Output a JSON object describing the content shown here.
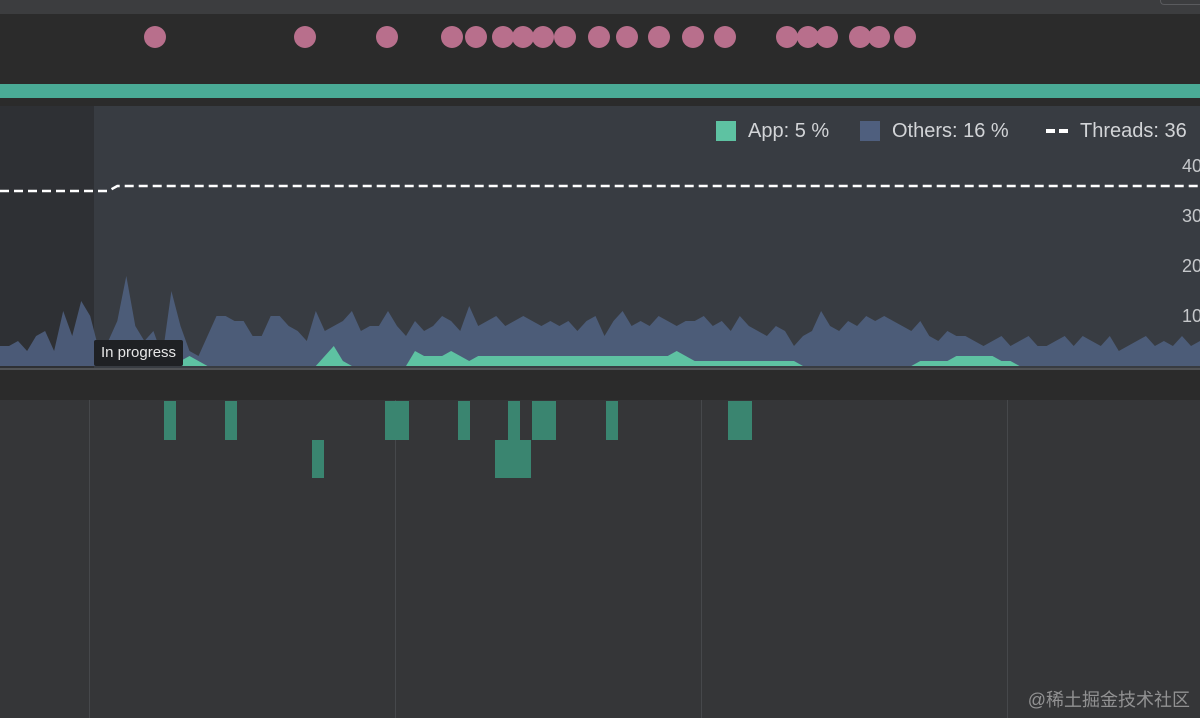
{
  "colors": {
    "app": "#5ec2a2",
    "others": "#4f5f7e",
    "threads": "#ffffff",
    "event": "#b86f8c",
    "status": "#4aab96",
    "thread_block": "#3a8570"
  },
  "legend": {
    "app": "App: 5 %",
    "others": "Others: 16 %",
    "threads": "Threads: 36"
  },
  "axis": {
    "ticks": [
      "40",
      "30",
      "20",
      "10"
    ]
  },
  "tooltip": {
    "text": "In progress"
  },
  "watermark": {
    "text": "@稀土掘金技术社区"
  },
  "chart_data": {
    "type": "area",
    "ylim": [
      0,
      45
    ],
    "series": [
      {
        "name": "Others",
        "values": [
          4,
          4,
          5,
          3,
          6,
          7,
          3,
          11,
          6,
          13,
          10,
          3,
          5,
          9,
          18,
          8,
          5,
          7,
          2,
          15,
          8,
          3,
          2,
          6,
          10,
          10,
          9,
          9,
          6,
          6,
          10,
          10,
          8,
          7,
          5,
          11,
          7,
          8,
          9,
          11,
          7,
          8,
          8,
          11,
          8,
          6,
          9,
          7,
          8,
          10,
          9,
          7,
          12,
          8,
          9,
          10,
          8,
          9,
          10,
          9,
          8,
          9,
          8,
          9,
          7,
          9,
          10,
          6,
          9,
          11,
          8,
          9,
          8,
          10,
          9,
          8,
          9,
          9,
          10,
          8,
          9,
          7,
          10,
          8,
          7,
          6,
          8,
          7,
          4,
          6,
          7,
          11,
          8,
          7,
          9,
          8,
          10,
          9,
          10,
          9,
          8,
          7,
          9,
          6,
          5,
          7,
          6,
          6,
          5,
          4,
          5,
          6,
          4,
          5,
          6,
          4,
          4,
          5,
          6,
          4,
          6,
          5,
          4,
          6,
          3,
          4,
          5,
          6,
          4,
          5,
          4,
          6,
          4,
          5
        ]
      },
      {
        "name": "App",
        "values": [
          0,
          0,
          0,
          0,
          0,
          0,
          0,
          0,
          0,
          0,
          0,
          0,
          0,
          0,
          0,
          0,
          0,
          0,
          0,
          0,
          1,
          2,
          1,
          0,
          0,
          0,
          0,
          0,
          0,
          0,
          0,
          0,
          0,
          0,
          0,
          0,
          2,
          4,
          1,
          0,
          0,
          0,
          0,
          0,
          0,
          0,
          3,
          2,
          2,
          2,
          3,
          2,
          1,
          2,
          2,
          2,
          2,
          2,
          2,
          2,
          2,
          2,
          2,
          2,
          2,
          2,
          2,
          2,
          2,
          2,
          2,
          2,
          2,
          2,
          2,
          3,
          2,
          1,
          1,
          1,
          1,
          1,
          1,
          1,
          1,
          1,
          1,
          1,
          1,
          0,
          0,
          0,
          0,
          0,
          0,
          0,
          0,
          0,
          0,
          0,
          0,
          0,
          1,
          1,
          1,
          1,
          2,
          2,
          2,
          2,
          2,
          1,
          1,
          0,
          0,
          0,
          0,
          0,
          0,
          0,
          0,
          0,
          0,
          0,
          0,
          0,
          0,
          0,
          0,
          0,
          0,
          0,
          0,
          0
        ]
      },
      {
        "name": "Threads",
        "values": [
          35,
          35,
          35,
          35,
          35,
          35,
          35,
          35,
          35,
          35,
          35,
          35,
          35,
          36,
          36,
          36,
          36,
          36,
          36,
          36,
          36,
          36,
          36,
          36,
          36,
          36,
          36,
          36,
          36,
          36,
          36,
          36,
          36,
          36,
          36,
          36,
          36,
          36,
          36,
          36,
          36,
          36,
          36,
          36,
          36,
          36,
          36,
          36,
          36,
          36,
          36,
          36,
          36,
          36,
          36,
          36,
          36,
          36,
          36,
          36,
          36,
          36,
          36,
          36,
          36,
          36,
          36,
          36,
          36,
          36,
          36,
          36,
          36,
          36,
          36,
          36,
          36,
          36,
          36,
          36,
          36,
          36,
          36,
          36,
          36,
          36,
          36,
          36,
          36,
          36,
          36,
          36,
          36,
          36,
          36,
          36,
          36,
          36,
          36,
          36,
          36,
          36,
          36,
          36,
          36,
          36,
          36,
          36,
          36,
          36,
          36,
          36,
          36,
          36,
          36,
          36,
          36,
          36,
          36,
          36,
          36,
          36,
          36,
          36,
          36,
          36,
          36,
          36,
          36,
          36,
          36,
          36,
          36,
          36
        ]
      }
    ]
  }
}
